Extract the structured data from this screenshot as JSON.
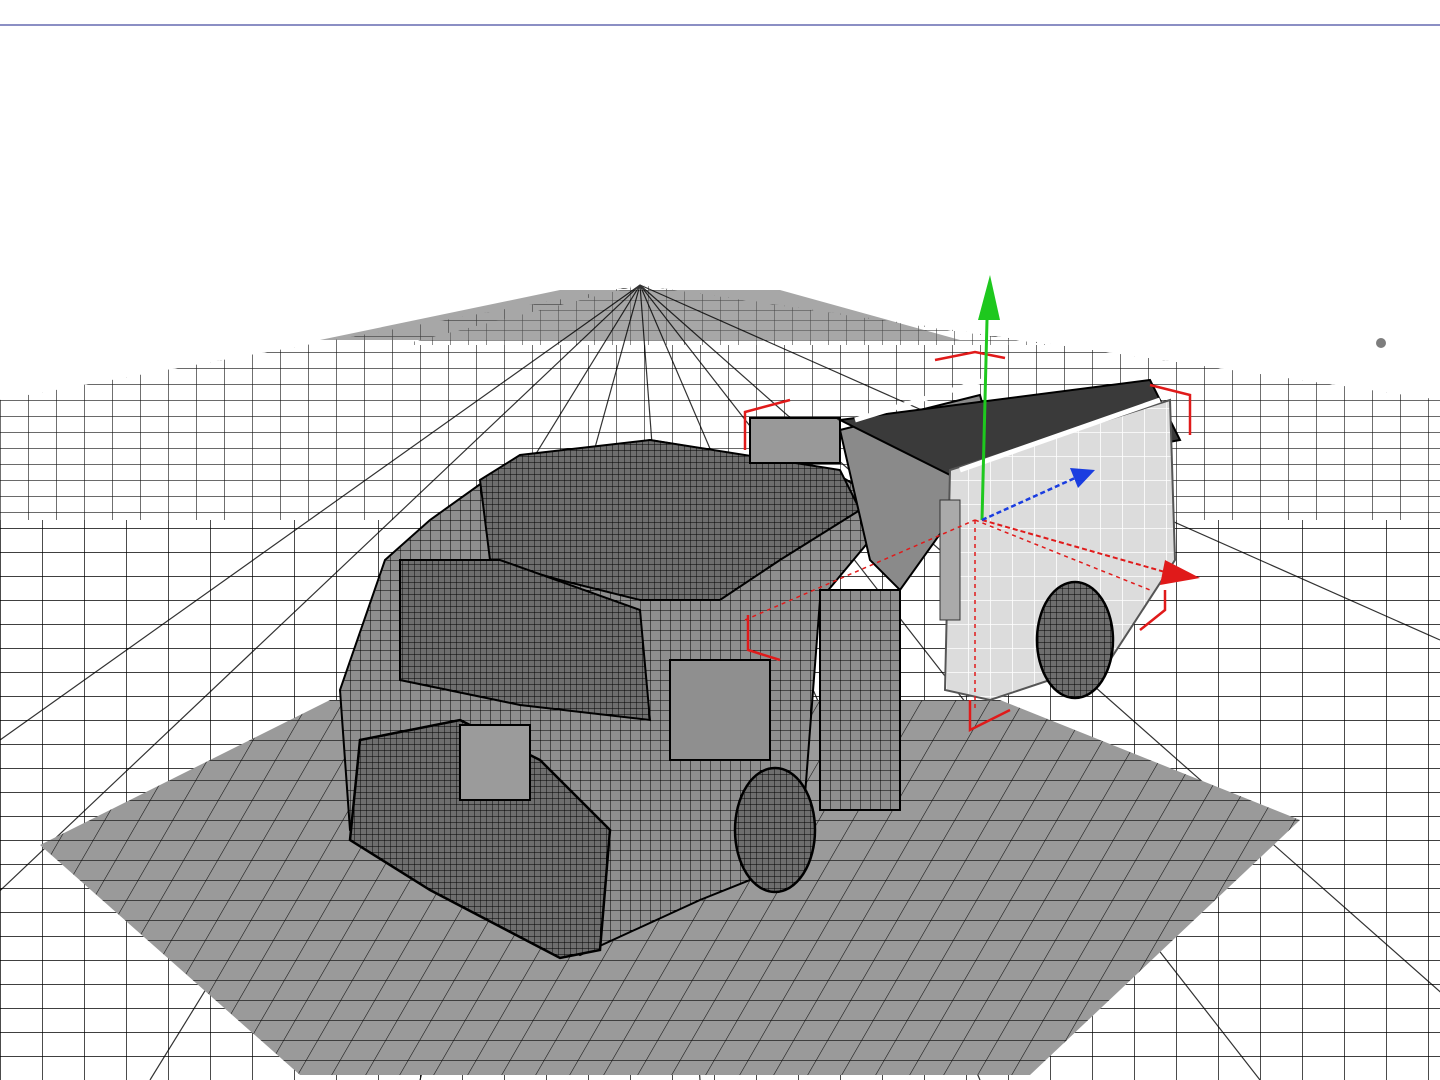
{
  "viewport": {
    "view": "perspective",
    "render_mode": "wireframe-shaded"
  },
  "scene": {
    "object": "fire-truck-model",
    "selected_part": "rear-compartment"
  },
  "gizmo": {
    "type": "move",
    "axes": [
      {
        "name": "y",
        "color": "#1ec81e"
      },
      {
        "name": "x",
        "color": "#e01a1a"
      },
      {
        "name": "z",
        "color": "#1a3de0"
      }
    ]
  },
  "colors": {
    "grid_line": "#000000",
    "shadow": "#9a9a9a",
    "model_body": "#8f8f8f",
    "model_wire": "#000000",
    "selection_box": "#e01a1a",
    "border": "#8b8fc4"
  }
}
